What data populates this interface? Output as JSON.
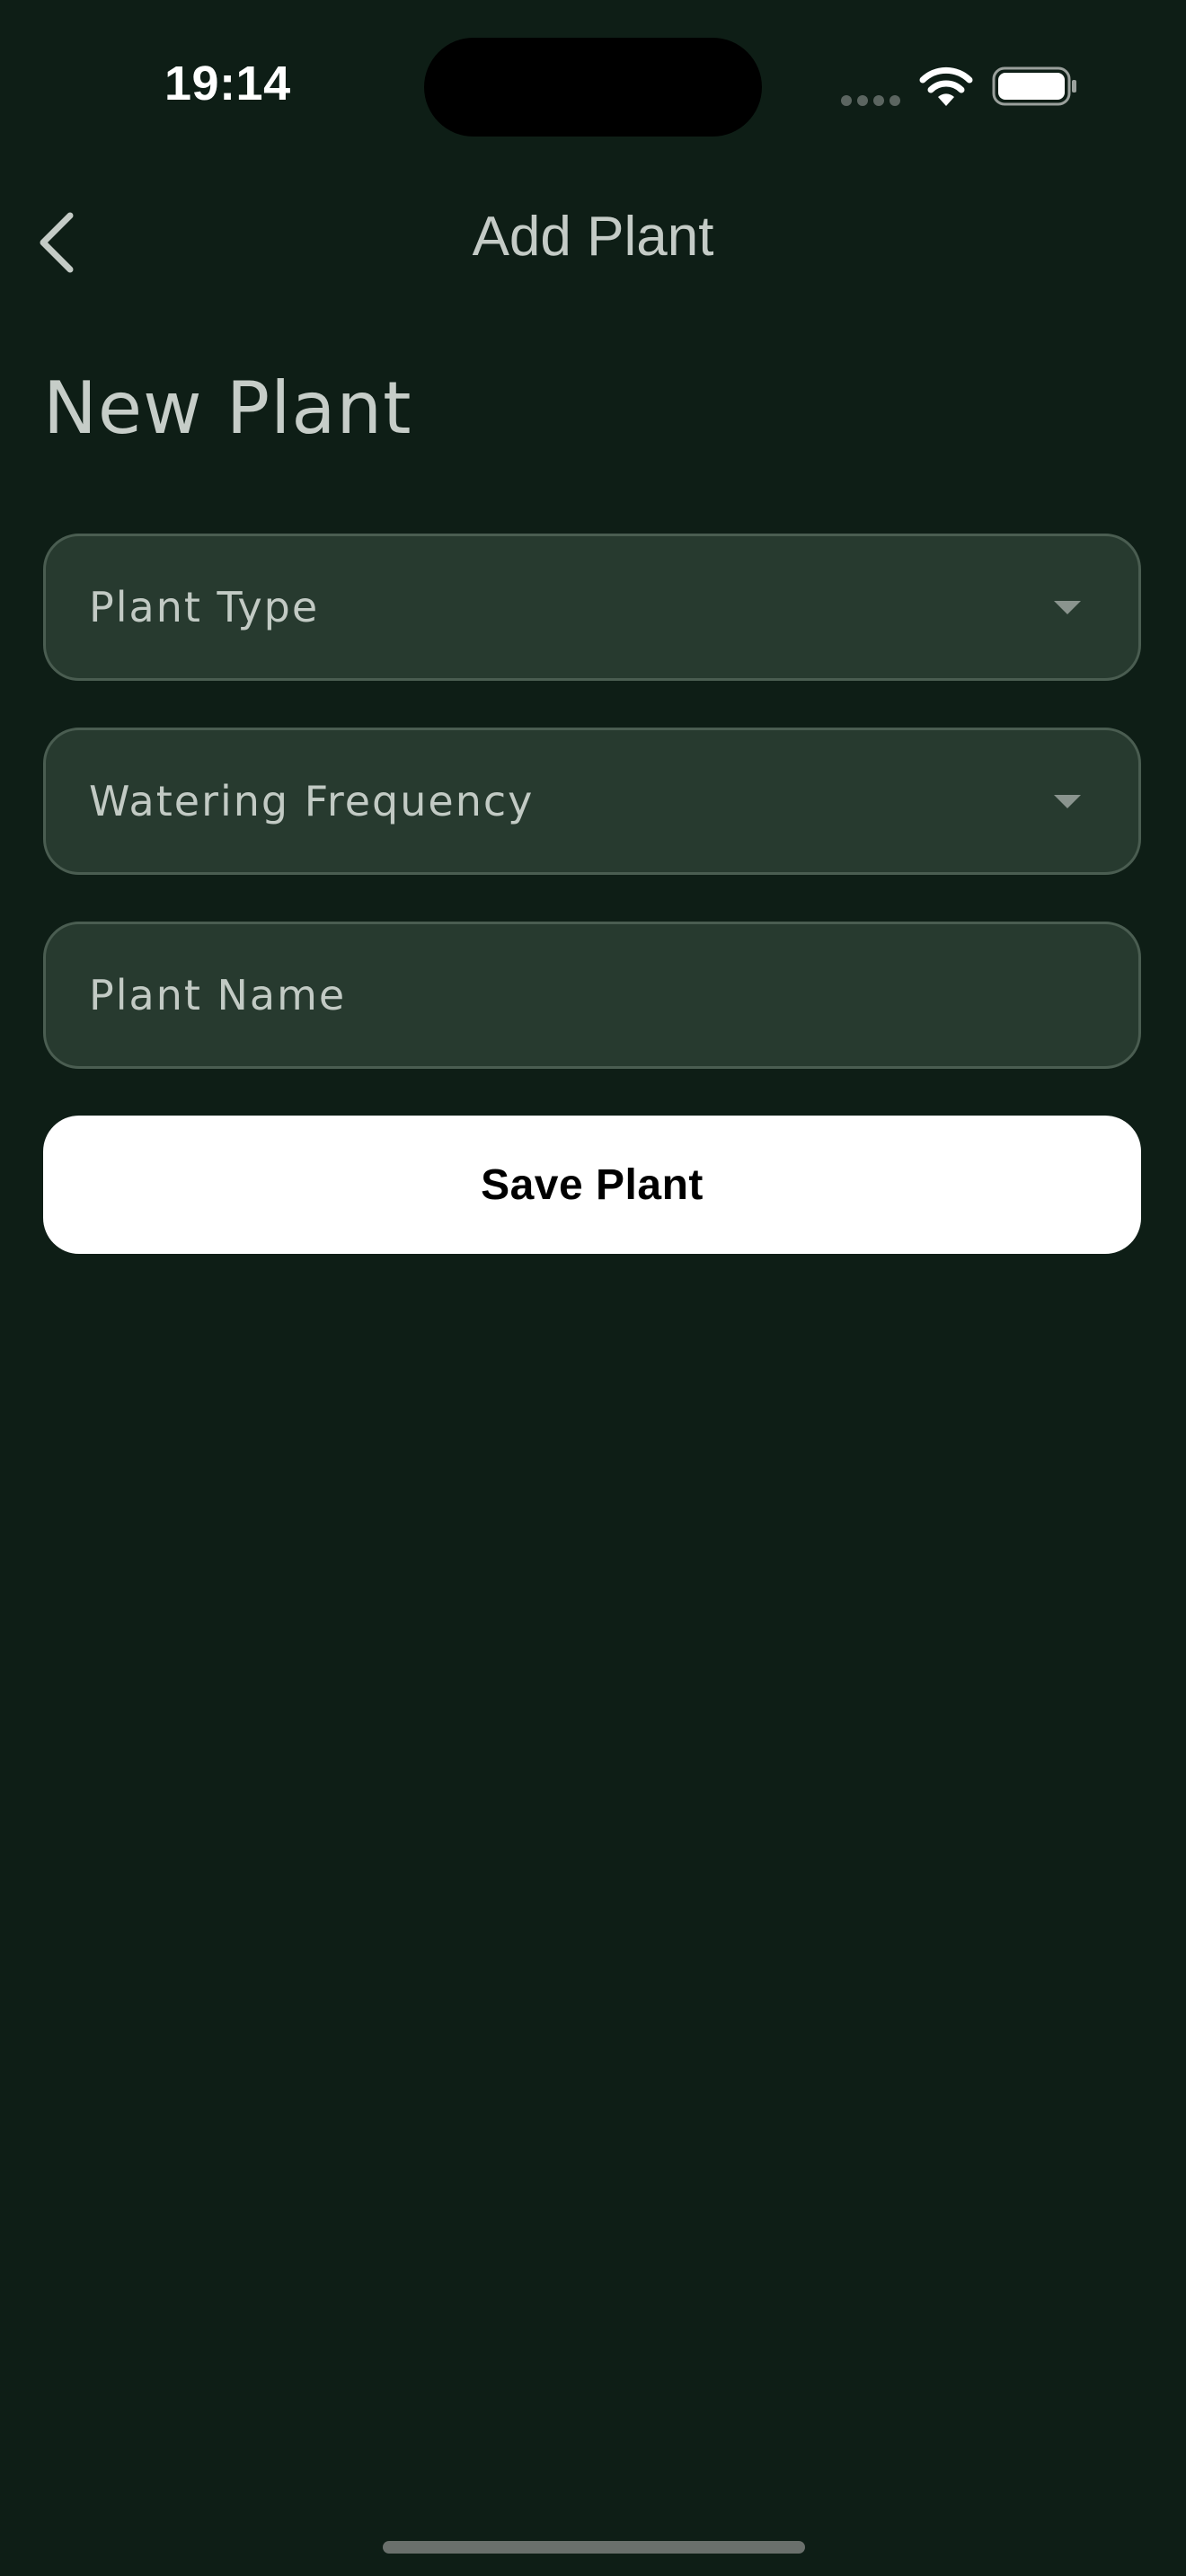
{
  "status_bar": {
    "time": "19:14",
    "icons": [
      "signal-icon",
      "wifi-icon",
      "battery-icon"
    ]
  },
  "nav": {
    "back_icon": "chevron-left-icon",
    "title": "Add Plant"
  },
  "page": {
    "heading": "New Plant"
  },
  "form": {
    "plant_type": {
      "label": "Plant Type",
      "icon": "dropdown-caret-icon"
    },
    "watering_frequency": {
      "label": "Watering Frequency",
      "icon": "dropdown-caret-icon"
    },
    "plant_name": {
      "placeholder": "Plant Name",
      "value": ""
    },
    "save_label": "Save Plant"
  },
  "colors": {
    "background": "#0e1e16",
    "field_background": "#273a2f",
    "field_border": "#4a5d51",
    "primary_button": "#ffffff",
    "primary_button_text": "#000000"
  }
}
